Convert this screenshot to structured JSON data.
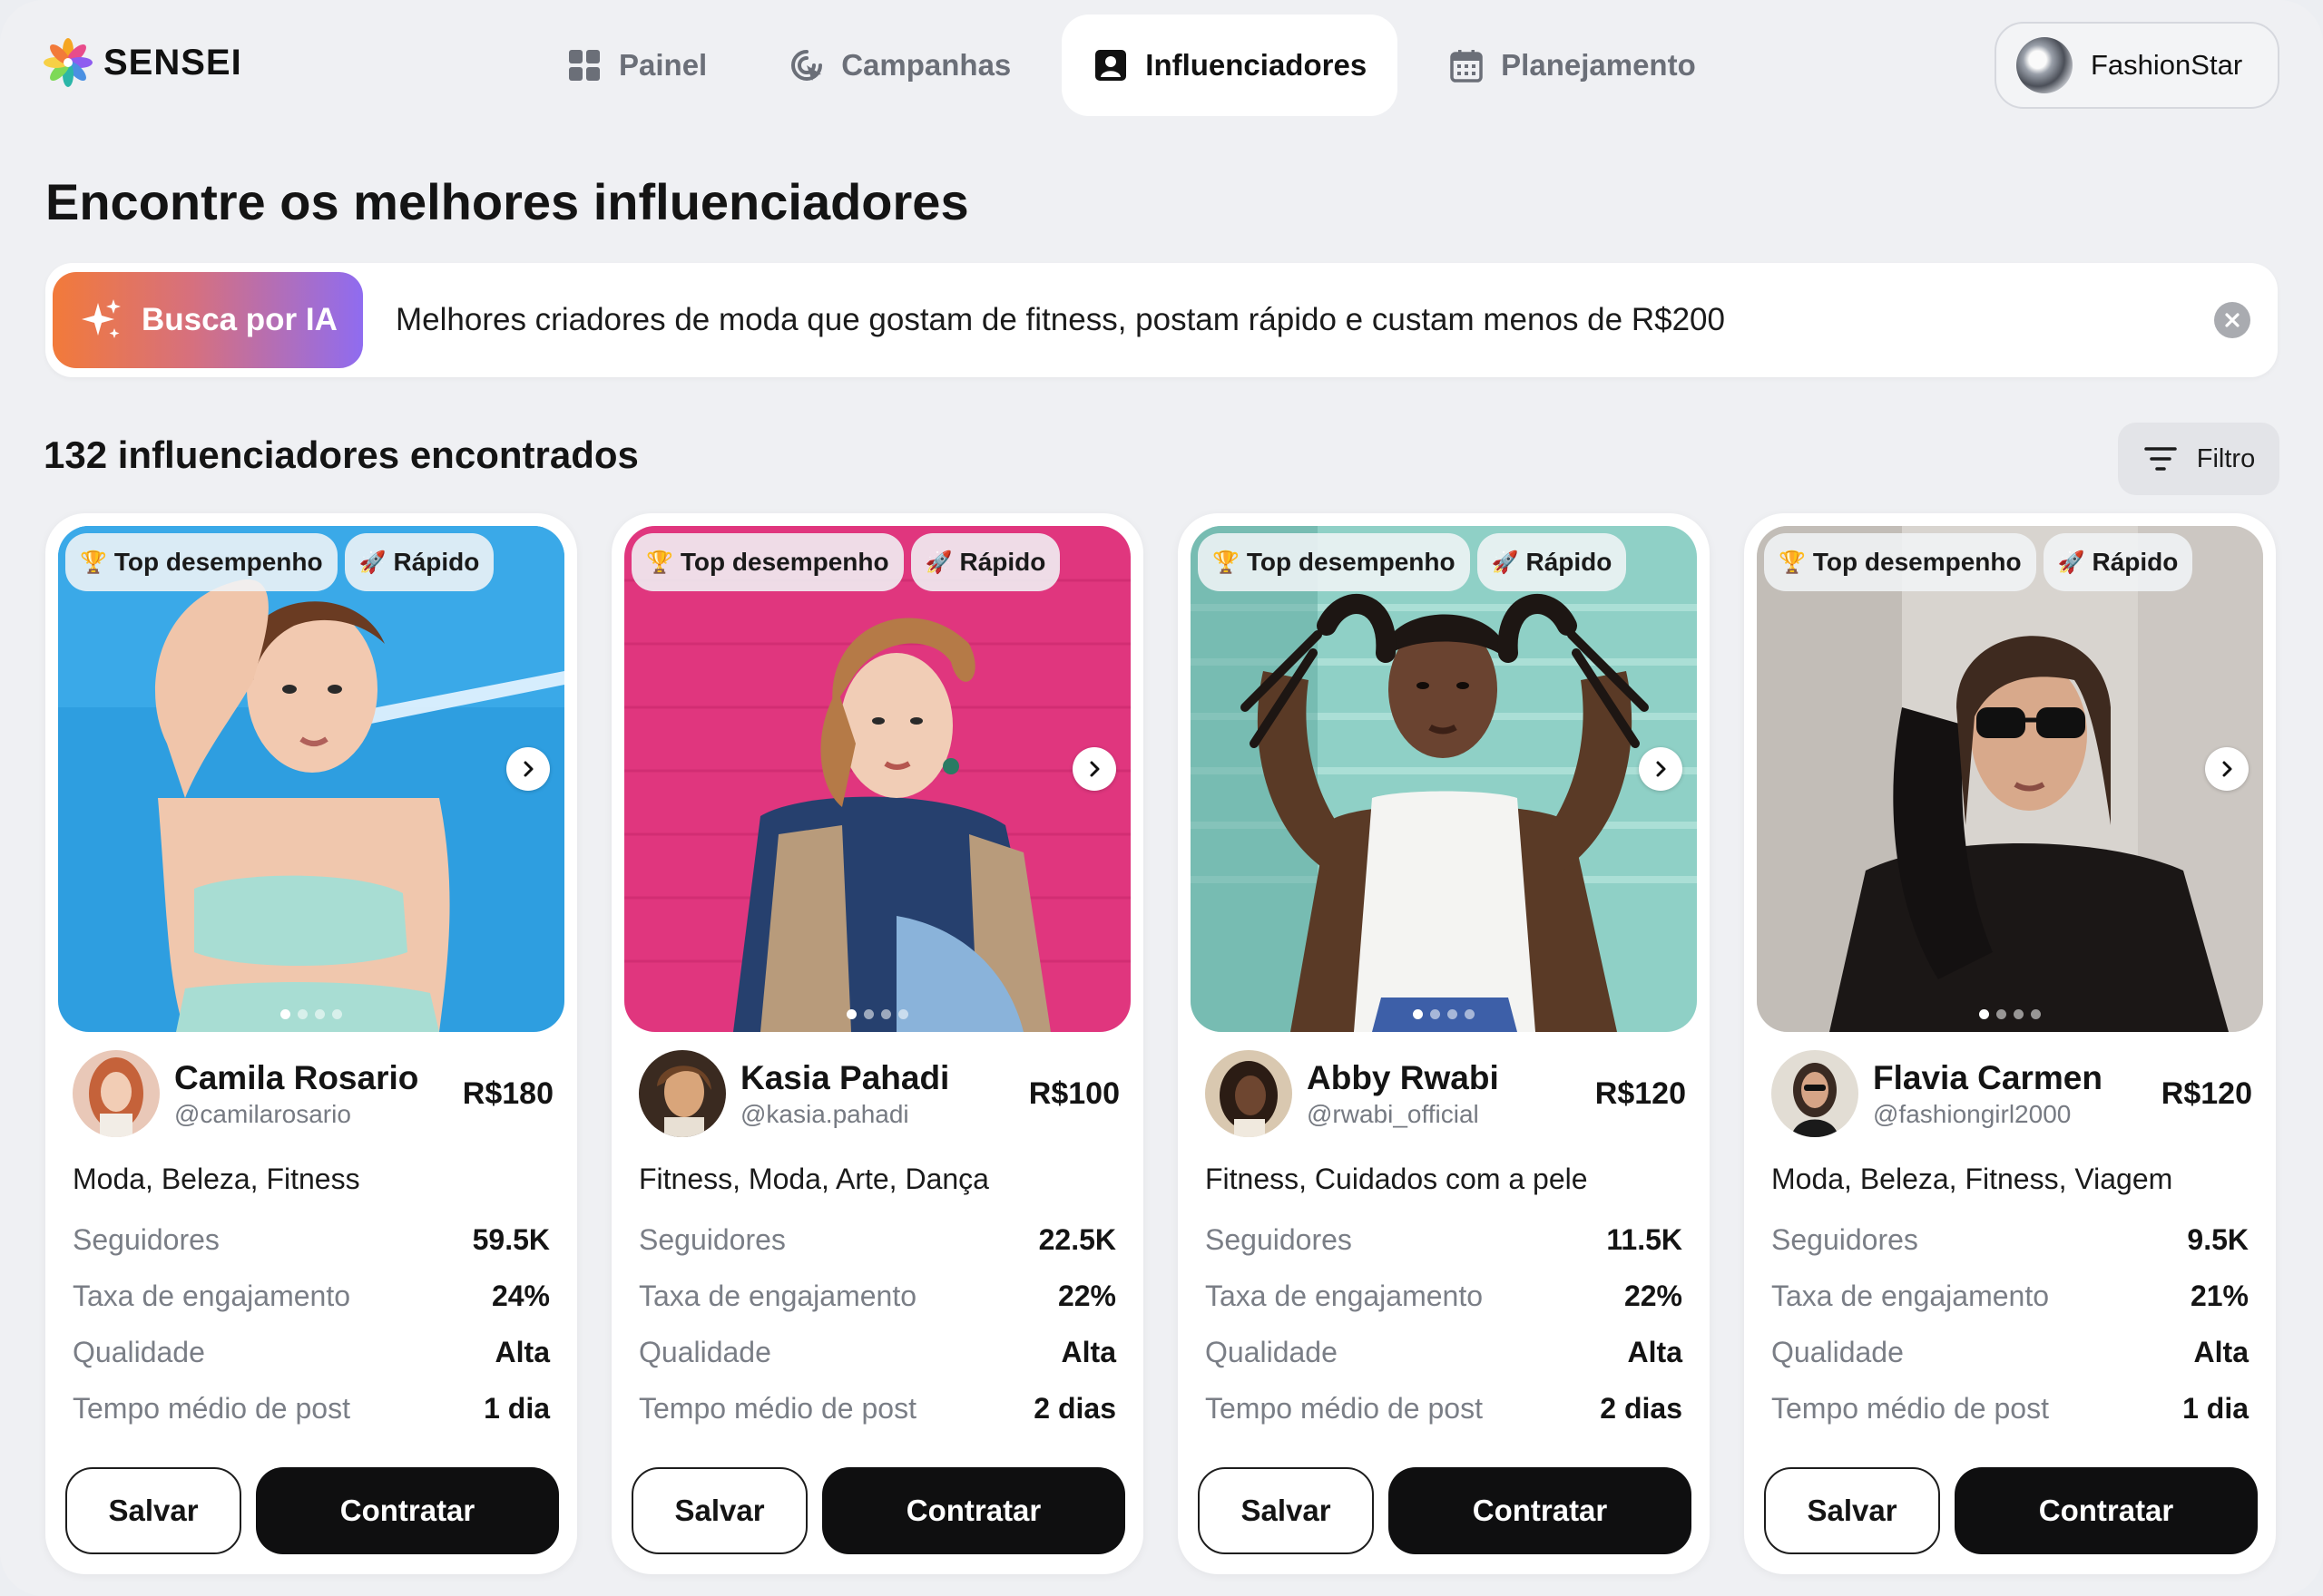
{
  "app": {
    "logo_text": "SENSEI",
    "logo_icon": "flower-logo"
  },
  "nav": [
    {
      "label": "Painel",
      "icon": "dashboard-grid-icon",
      "active": false
    },
    {
      "label": "Campanhas",
      "icon": "campaign-target-icon",
      "active": false
    },
    {
      "label": "Influenciadores",
      "icon": "person-profile-icon",
      "active": true
    },
    {
      "label": "Planejamento",
      "icon": "calendar-icon",
      "active": false
    }
  ],
  "account": {
    "name": "FashionStar"
  },
  "page": {
    "title": "Encontre os melhores influenciadores"
  },
  "search": {
    "ai_button": "Busca por IA",
    "query": "Melhores criadores de moda que gostam de fitness, postam rápido e custam menos de R$200"
  },
  "results": {
    "count_text": "132 influenciadores encontrados",
    "filter_label": "Filtro"
  },
  "labels": {
    "followers": "Seguidores",
    "engagement": "Taxa de engajamento",
    "quality": "Qualidade",
    "post_time": "Tempo médio de post",
    "save": "Salvar",
    "hire": "Contratar",
    "badge_top": "Top desempenho",
    "badge_fast": "Rápido"
  },
  "colors": {
    "accent_gradient_start": "#f27a3a",
    "accent_gradient_end": "#8f6cf0",
    "primary_button": "#0f0f10"
  },
  "influencers": [
    {
      "name": "Camila Rosario",
      "handle": "@camilarosario",
      "price": "R$180",
      "categories": "Moda, Beleza, Fitness",
      "followers": "59.5K",
      "engagement": "24%",
      "quality": "Alta",
      "post_time": "1 dia"
    },
    {
      "name": "Kasia Pahadi",
      "handle": "@kasia.pahadi",
      "price": "R$100",
      "categories": "Fitness, Moda, Arte, Dança",
      "followers": "22.5K",
      "engagement": "22%",
      "quality": "Alta",
      "post_time": "2 dias"
    },
    {
      "name": "Abby Rwabi",
      "handle": "@rwabi_official",
      "price": "R$120",
      "categories": "Fitness, Cuidados com a pele",
      "followers": "11.5K",
      "engagement": "22%",
      "quality": "Alta",
      "post_time": "2 dias"
    },
    {
      "name": "Flavia Carmen",
      "handle": "@fashiongirl2000",
      "price": "R$120",
      "categories": "Moda, Beleza, Fitness, Viagem",
      "followers": "9.5K",
      "engagement": "21%",
      "quality": "Alta",
      "post_time": "1 dia"
    }
  ]
}
